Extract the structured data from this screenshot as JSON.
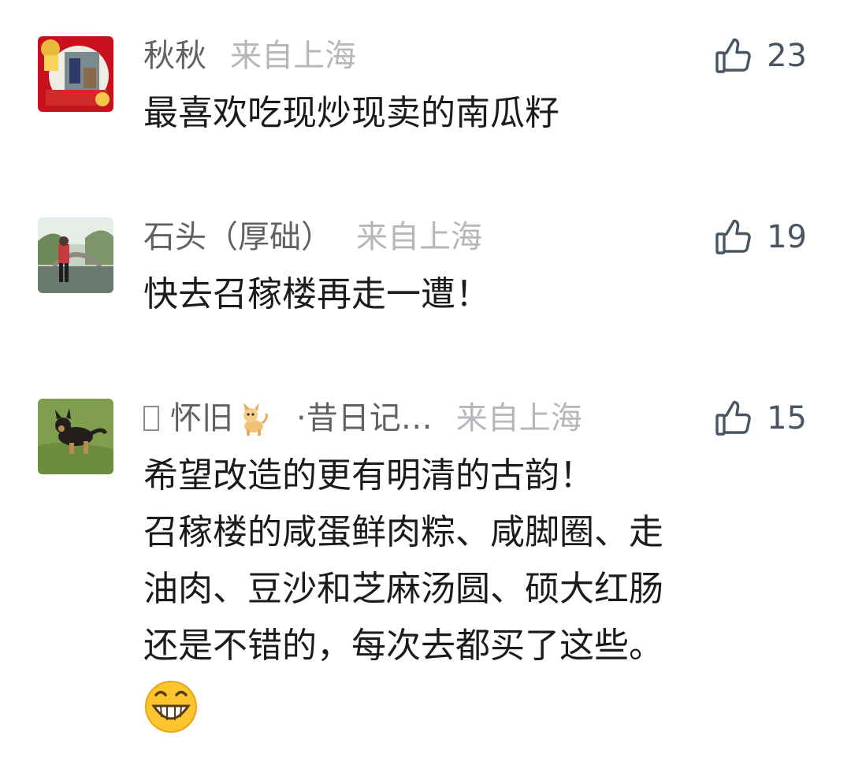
{
  "colors": {
    "nickname": "#5f6165",
    "location": "#b5b7ba",
    "content": "#1b1b1b",
    "like_icon": "#4a5563"
  },
  "comments": [
    {
      "nickname": "秋秋",
      "location": "来自上海",
      "likes": "23",
      "lines": [
        "最喜欢吃现炒现卖的南瓜籽"
      ],
      "avatar_icon": "new-year-photo-avatar"
    },
    {
      "nickname": "石头（厚础）",
      "location": "来自上海",
      "likes": "19",
      "lines": [
        "快去召稼楼再走一遭！"
      ],
      "avatar_icon": "bridge-photo-avatar"
    },
    {
      "nickname_icon": "unknown-glyph-box",
      "nickname": "怀旧",
      "nickname_badge": "dog-emoji",
      "nickname_suffix": "·昔日记…",
      "location": "来自上海",
      "likes": "15",
      "lines": [
        "希望改造的更有明清的古韵！",
        "召稼楼的咸蛋鲜肉粽、咸脚圈、走",
        "油肉、豆沙和芝麻汤圆、硕大红肠",
        "还是不错的，每次去都买了这些。"
      ],
      "trailing_emoji": "grinning-face-emoji",
      "avatar_icon": "dog-on-grass-avatar"
    }
  ]
}
